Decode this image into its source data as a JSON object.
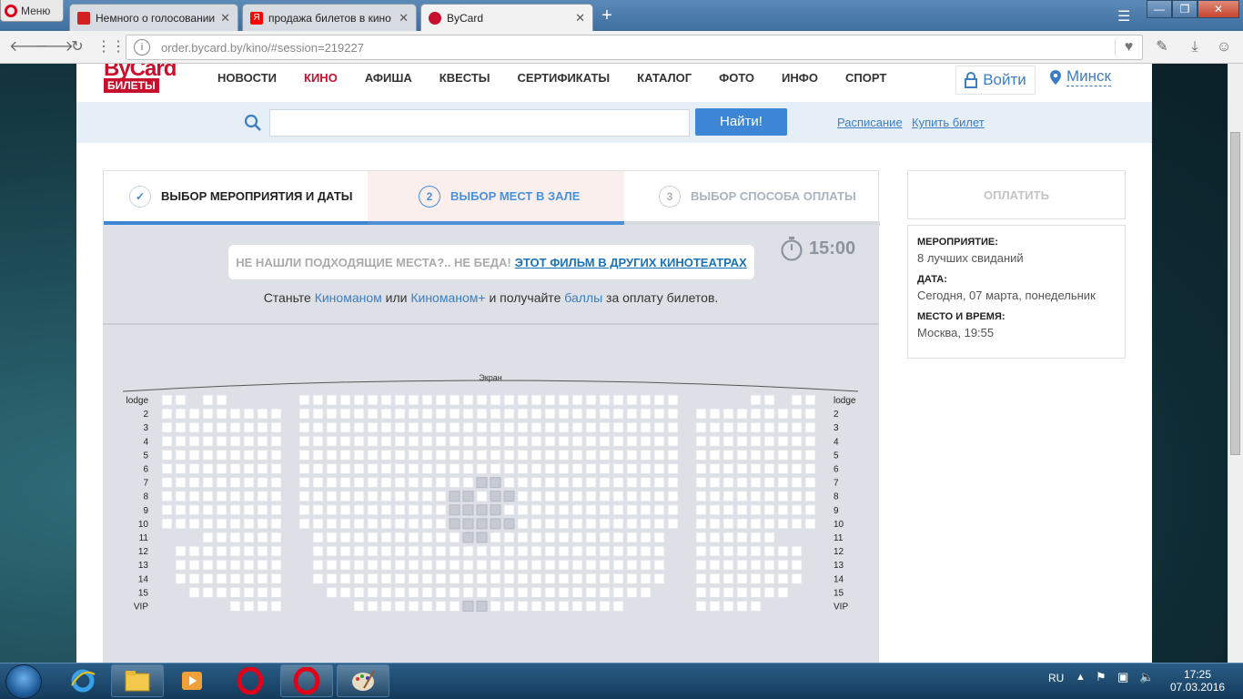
{
  "browser": {
    "menu_label": "Меню",
    "tabs": [
      {
        "title": "Немного о голосовании |",
        "favicon_color": "#d31f1f"
      },
      {
        "title": "продажа билетов в кино",
        "favicon_color": "#ff0000"
      },
      {
        "title": "ByCard",
        "favicon_color": "#c8102e"
      }
    ],
    "new_tab": "+",
    "url": "order.bycard.by/kino/#session=219227",
    "window_buttons": [
      "—",
      "❐",
      "✕"
    ]
  },
  "site": {
    "logo_top": "ByCard",
    "logo_bottom": "БИЛЕТЫ",
    "nav": [
      "НОВОСТИ",
      "КИНО",
      "АФИША",
      "КВЕСТЫ",
      "СЕРТИФИКАТЫ",
      "КАТАЛОГ",
      "ФОТО",
      "ИНФО",
      "СПОРТ"
    ],
    "active_nav": "КИНО",
    "login_label": "Войти",
    "city_label": "Минск",
    "search_placeholder": "",
    "find_button": "Найти!",
    "schedule_link": "Расписание",
    "buy_link": "Купить билет",
    "accent_color": "#3d86d6",
    "brand_color": "#c8102e"
  },
  "steps": [
    {
      "num": "✓",
      "label": "ВЫБОР МЕРОПРИЯТИЯ И ДАТЫ",
      "state": "done"
    },
    {
      "num": "2",
      "label": "ВЫБОР МЕСТ В ЗАЛЕ",
      "state": "active"
    },
    {
      "num": "3",
      "label": "ВЫБОР СПОСОБА ОПЛАТЫ",
      "state": "pending"
    }
  ],
  "hall": {
    "notice_text": "НЕ НАШЛИ ПОДХОДЯЩИЕ МЕСТА?.. НЕ БЕДА!",
    "notice_link": "ЭТОТ ФИЛЬМ В ДРУГИХ КИНОТЕАТРАХ",
    "timer": "15:00",
    "promo_before": "Станьте",
    "promo_kino1": "Киноманом",
    "promo_or": "или",
    "promo_kino2": "Киноманом+",
    "promo_and": "и получайте",
    "promo_points": "баллы",
    "promo_after": "за оплату билетов.",
    "screen_label": "Экран",
    "rows": [
      "lodge",
      "2",
      "3",
      "4",
      "5",
      "6",
      "7",
      "8",
      "9",
      "10",
      "11",
      "12",
      "13",
      "14",
      "15",
      "VIP"
    ]
  },
  "order": {
    "pay_button": "ОПЛАТИТЬ",
    "event_label": "МЕРОПРИЯТИЕ:",
    "event_value": "8 лучших свиданий",
    "date_label": "ДАТА:",
    "date_value": "Сегодня, 07 марта, понедельник",
    "place_label": "МЕСТО И ВРЕМЯ:",
    "place_value": "Москва, 19:55"
  },
  "taskbar": {
    "lang": "RU",
    "time": "17:25",
    "date": "07.03.2016"
  }
}
